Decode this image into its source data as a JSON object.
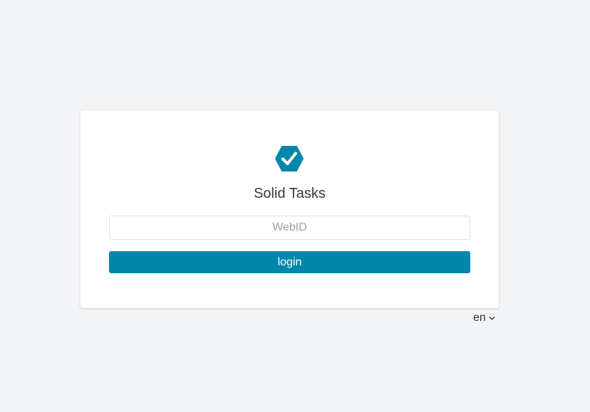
{
  "app": {
    "title": "Solid Tasks",
    "logo_icon": "hexagon-check-icon",
    "accent_color": "#0087ab"
  },
  "login": {
    "webid_placeholder": "WebID",
    "webid_value": "",
    "button_label": "login"
  },
  "language": {
    "selected": "en",
    "icon": "chevron-down-icon"
  }
}
